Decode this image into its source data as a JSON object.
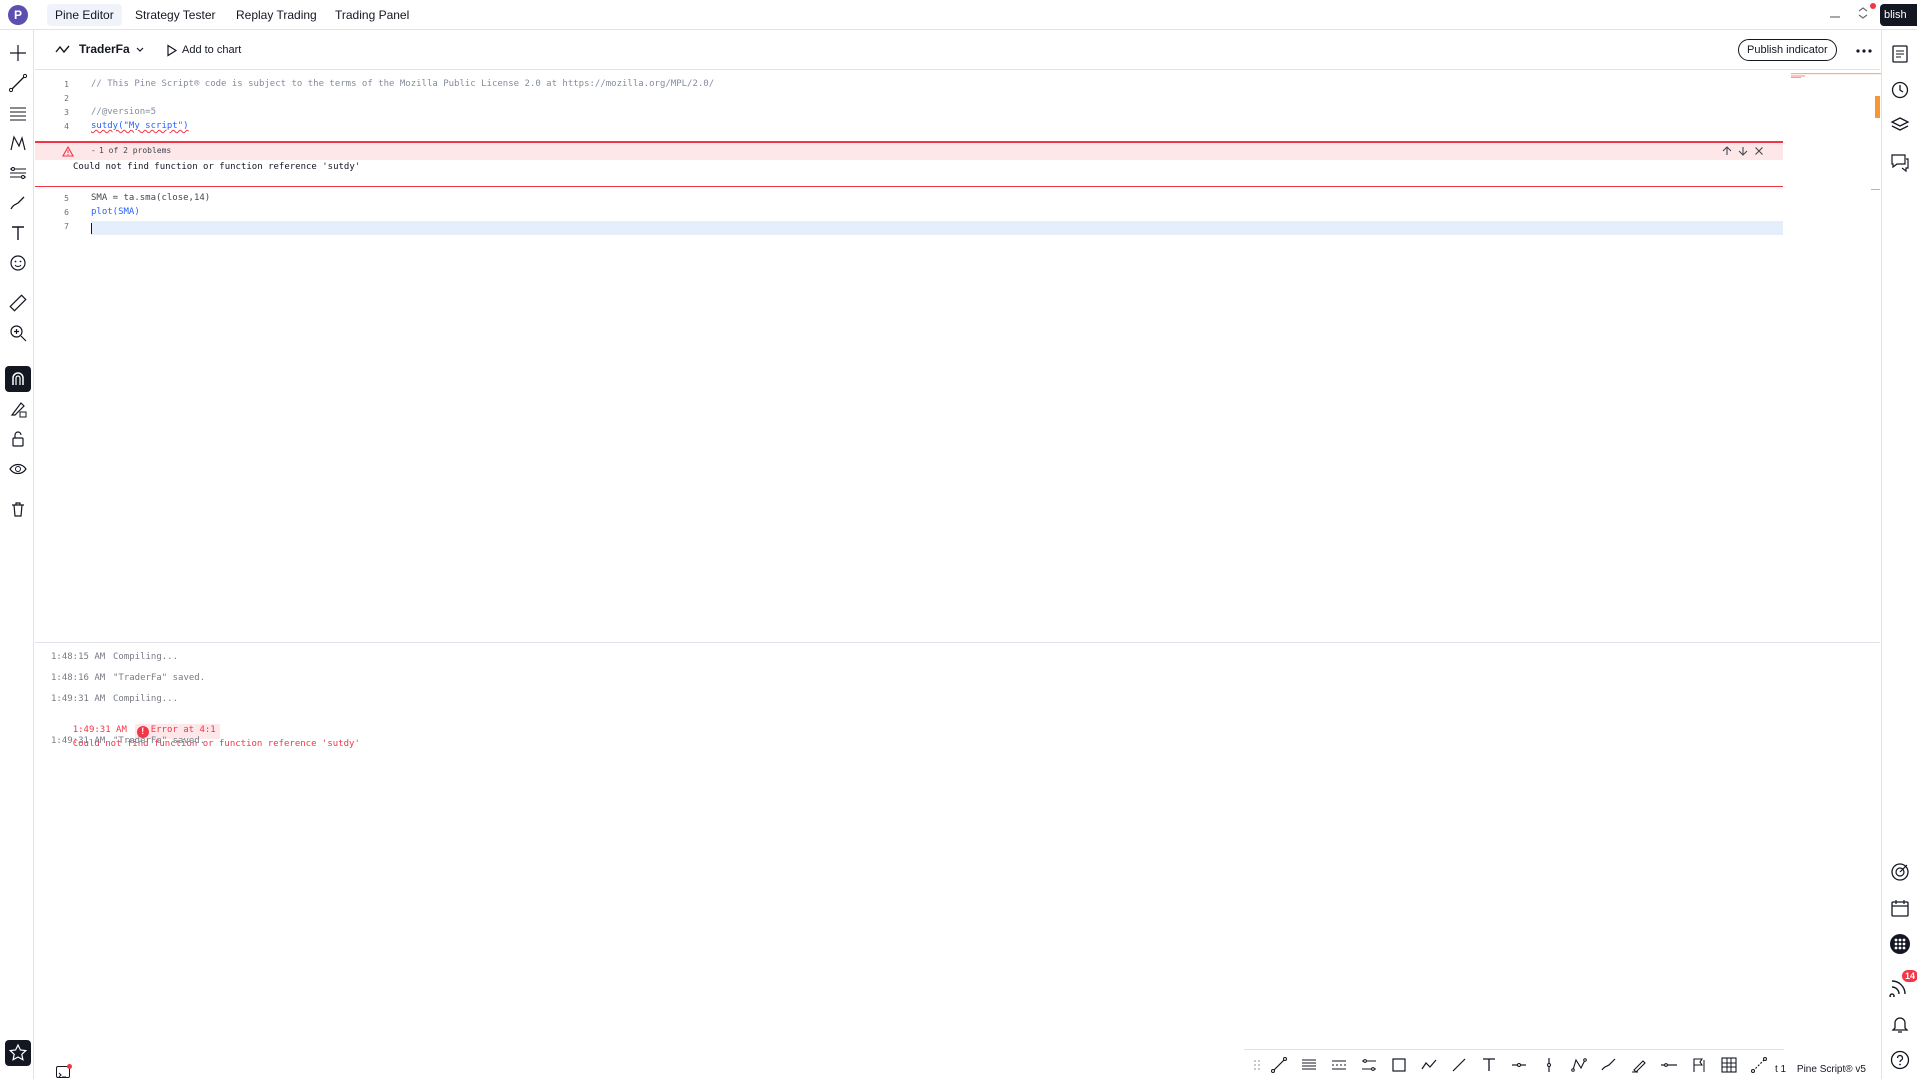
{
  "app": {
    "avatar_letter": "P",
    "tabs": [
      "Pine Editor",
      "Strategy Tester",
      "Replay Trading",
      "Trading Panel"
    ],
    "publish_short": "blish"
  },
  "editor": {
    "script_name": "TraderFa",
    "add_to_chart": "Add to chart",
    "publish_indicator": "Publish indicator",
    "lines": [
      {
        "num": "1",
        "text": "// This Pine Script® code is subject to the terms of the Mozilla Public License 2.0 at https://mozilla.org/MPL/2.0/"
      },
      {
        "num": "2",
        "text": ""
      },
      {
        "num": "3",
        "text": "//@version=5"
      },
      {
        "num": "4",
        "text": "sutdy(\"My script\")"
      },
      {
        "num": "5",
        "text": "SMA = ta.sma(close,14)"
      },
      {
        "num": "6",
        "text": "plot(SMA)"
      },
      {
        "num": "7",
        "text": ""
      }
    ],
    "problem_counter": "1 of 2 problems",
    "problem_message": "Could not find function or function reference 'sutdy'"
  },
  "console": {
    "logs": [
      {
        "time": "1:48:15 AM",
        "text": "Compiling...",
        "error": false
      },
      {
        "time": "1:48:16 AM",
        "text": "\"TraderFa\" saved.",
        "error": false
      },
      {
        "time": "1:49:31 AM",
        "text": "Compiling...",
        "error": false
      },
      {
        "time": "1:49:31 AM",
        "label": "Error at 4:1",
        "text": "Could not find function or function reference 'sutdy'",
        "error": true
      },
      {
        "time": "1:49:31 AM",
        "text": "\"TraderFa\" saved.",
        "error": false
      }
    ]
  },
  "right_toolbar": {
    "notifications_badge": "14"
  },
  "status": {
    "left_fragment": "t 1",
    "pine_version": "Pine Script® v5"
  },
  "colors": {
    "error": "#f23645",
    "accent": "#2962ff",
    "active_dark": "#131722"
  }
}
